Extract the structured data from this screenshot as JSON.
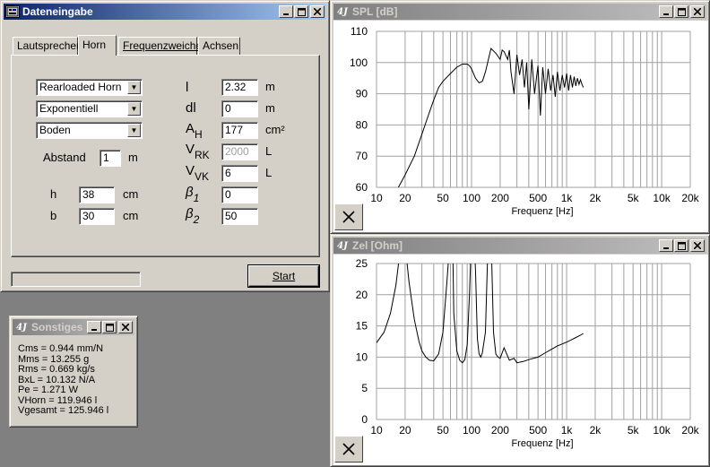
{
  "dateneingabe": {
    "title": "Dateneingabe",
    "tabs": [
      "Lautsprecher",
      "Horn",
      "Frequenzweiche",
      "Achsen"
    ],
    "selected_tab": "Horn",
    "horn_type": "Rearloaded Horn",
    "flare": "Exponentiell",
    "placement": "Boden",
    "abstand_label": "Abstand",
    "abstand_value": "1",
    "abstand_unit": "m",
    "h_label": "h",
    "h_value": "38",
    "h_unit": "cm",
    "b_label": "b",
    "b_value": "30",
    "b_unit": "cm",
    "params": {
      "l": {
        "sym": "l",
        "sub": "",
        "value": "2.32",
        "unit": "m"
      },
      "dl": {
        "sym": "dl",
        "sub": "",
        "value": "0",
        "unit": "m"
      },
      "ah": {
        "sym": "A",
        "sub": "H",
        "value": "177",
        "unit": "cm²"
      },
      "vrk": {
        "sym": "V",
        "sub": "RK",
        "value": "2000",
        "unit": "L"
      },
      "vvk": {
        "sym": "V",
        "sub": "VK",
        "value": "6",
        "unit": "L"
      },
      "b1": {
        "sym": "β",
        "sub": "1",
        "value": "0",
        "unit": ""
      },
      "b2": {
        "sym": "β",
        "sub": "2",
        "value": "50",
        "unit": ""
      }
    },
    "start_label": "Start"
  },
  "sonstiges": {
    "title": "Sonstiges",
    "lines": [
      "Cms = 0.944 mm/N",
      "Mms = 13.255 g",
      "Rms = 0.669 kg/s",
      "BxL = 10.132 N/A",
      "Pe = 1.271 W",
      "VHorn = 119.946 l",
      "Vgesamt = 125.946 l"
    ]
  },
  "icons": {
    "app": "4J-logo-icon",
    "minimize": "minimize-icon",
    "maximize": "maximize-icon",
    "close": "close-icon",
    "dropdown": "chevron-down-icon"
  },
  "chart_data": [
    {
      "type": "line",
      "title": "SPL [dB]",
      "xlabel": "Frequenz [Hz]",
      "x_scale": "log",
      "xlim": [
        10,
        20000
      ],
      "ylim": [
        60,
        110
      ],
      "x_ticks": [
        "10",
        "20",
        "50",
        "100",
        "200",
        "500",
        "1k",
        "2k",
        "5k",
        "10k",
        "20k"
      ],
      "y_ticks": [
        "110",
        "100",
        "90",
        "80",
        "70",
        "60"
      ],
      "grid": true,
      "series": [
        {
          "x": [
            17,
            20,
            25,
            30,
            35,
            40,
            45,
            50,
            60,
            70,
            80,
            90,
            95,
            100,
            110,
            120,
            130,
            140,
            160,
            180,
            200,
            210,
            220,
            240,
            250,
            260,
            280,
            300,
            320,
            340,
            360,
            380,
            400,
            430,
            460,
            500,
            530,
            560,
            600,
            640,
            680,
            720,
            760,
            800,
            850,
            900,
            950,
            1000,
            1050,
            1100,
            1150,
            1200,
            1250,
            1300,
            1350,
            1400,
            1450,
            1500
          ],
          "y": [
            60,
            64,
            70,
            77,
            83,
            88,
            92,
            94,
            96.5,
            98.5,
            99.5,
            99.5,
            99,
            98,
            95,
            93.5,
            94,
            97,
            104.5,
            103,
            101,
            104,
            103.5,
            101,
            104,
            97,
            90,
            102.5,
            96,
            101,
            92,
            100,
            85,
            101,
            90,
            99,
            83,
            98.5,
            90,
            98,
            91,
            96,
            89,
            97,
            91,
            96,
            92,
            96.5,
            91,
            96,
            92,
            95.5,
            92.5,
            95,
            93,
            94.5,
            93,
            92
          ]
        }
      ]
    },
    {
      "type": "line",
      "title": "Zel [Ohm]",
      "xlabel": "Frequenz [Hz]",
      "x_scale": "log",
      "xlim": [
        10,
        20000
      ],
      "ylim": [
        0,
        25
      ],
      "x_ticks": [
        "10",
        "20",
        "50",
        "100",
        "200",
        "500",
        "1k",
        "2k",
        "5k",
        "10k",
        "20k"
      ],
      "y_ticks": [
        "25",
        "20",
        "15",
        "10",
        "5",
        "0"
      ],
      "grid": true,
      "series": [
        {
          "x": [
            10,
            12,
            14,
            16,
            18,
            20,
            22,
            25,
            28,
            30,
            33,
            36,
            40,
            45,
            50,
            55,
            60,
            63,
            65,
            70,
            75,
            80,
            85,
            90,
            95,
            100,
            105,
            110,
            115,
            120,
            125,
            130,
            140,
            150,
            160,
            170,
            180,
            190,
            200,
            220,
            250,
            280,
            300,
            350,
            400,
            500,
            600,
            700,
            800,
            1000,
            1200,
            1400,
            1500
          ],
          "y": [
            12.3,
            14,
            17,
            21.5,
            28,
            28,
            22,
            16,
            12.5,
            11,
            10,
            9.5,
            9.4,
            10.5,
            14,
            22,
            30,
            30,
            17,
            11,
            9.5,
            9.1,
            9.6,
            12,
            20,
            30,
            30,
            24,
            13,
            10.5,
            10,
            10.7,
            14,
            30,
            30,
            14,
            10.5,
            10,
            9.8,
            11.5,
            9.5,
            9.8,
            9.1,
            9.3,
            9.6,
            10,
            10.7,
            11.3,
            11.8,
            12.4,
            13,
            13.5,
            13.8
          ]
        }
      ]
    }
  ]
}
